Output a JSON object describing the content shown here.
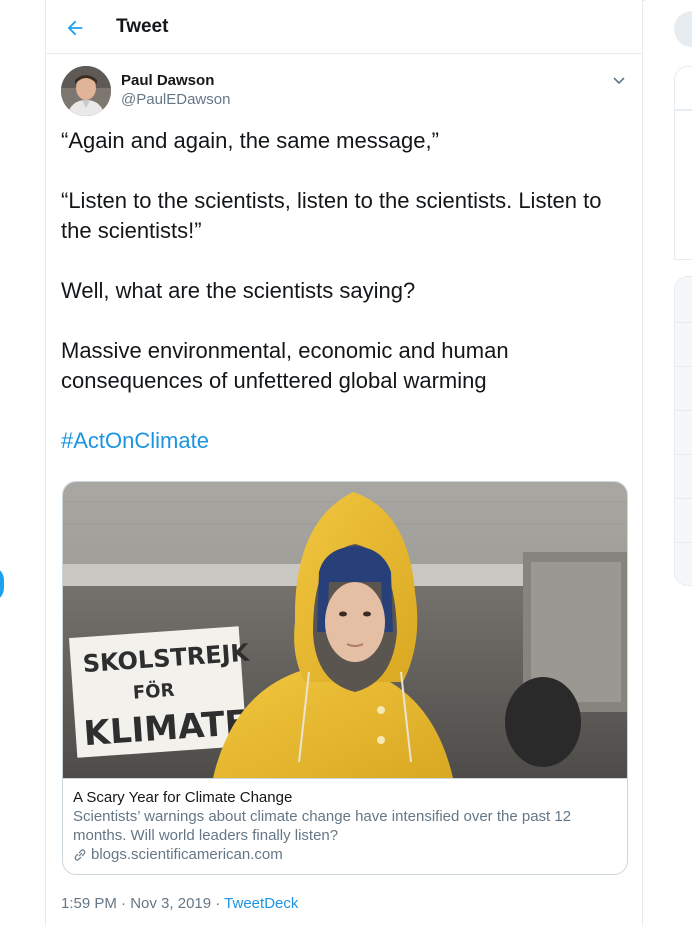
{
  "header": {
    "title": "Tweet"
  },
  "author": {
    "name": "Paul Dawson",
    "handle": "@PaulEDawson"
  },
  "tweet": {
    "lines": [
      "“Again and again, the same message,”",
      "“Listen to the scientists, listen to the scientists. Listen to the scientists!”",
      "Well, what are the scientists saying?",
      "Massive environmental, economic and human consequences of unfettered global warming"
    ],
    "hashtag": "#ActOnClimate",
    "sign_text": "SKOLSTREJK FÖR KLIMATET"
  },
  "card": {
    "title": "A Scary Year for Climate Change",
    "description": "Scientists’ warnings about climate change have intensified over the past 12 months. Will world leaders finally listen?",
    "domain": "blogs.scientificamerican.com"
  },
  "meta": {
    "time": "1:59 PM",
    "sep1": " · ",
    "date": "Nov 3, 2019",
    "sep2": " · ",
    "source": "TweetDeck"
  },
  "colors": {
    "accent": "#1da1f2",
    "link": "#1b95e0",
    "muted": "#657786",
    "border": "#e6ecf0"
  },
  "icons": {
    "back": "arrow-left-icon",
    "caret": "chevron-down-icon",
    "link": "link-icon"
  }
}
